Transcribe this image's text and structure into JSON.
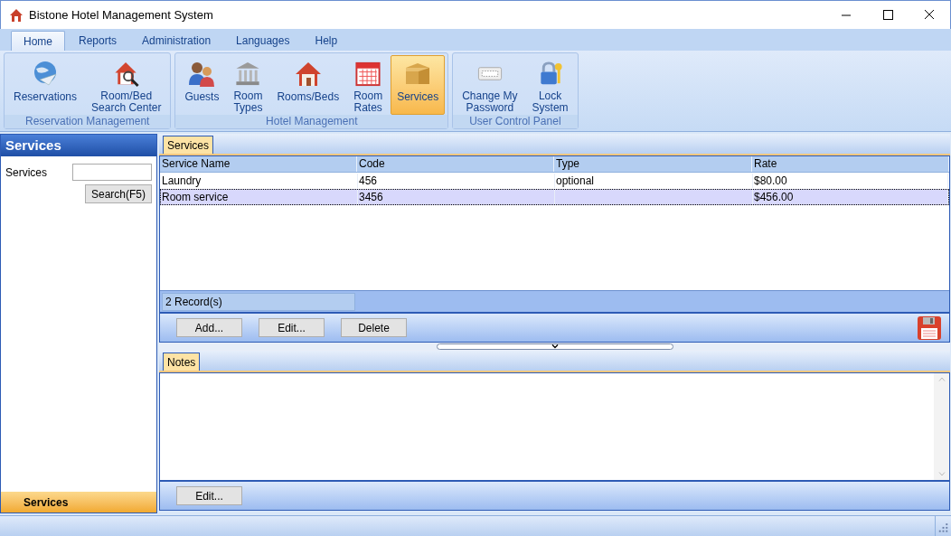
{
  "window": {
    "title": "Bistone Hotel Management System"
  },
  "ribbon_tabs": [
    {
      "label": "Home",
      "selected": true
    },
    {
      "label": "Reports",
      "selected": false
    },
    {
      "label": "Administration",
      "selected": false
    },
    {
      "label": "Languages",
      "selected": false
    },
    {
      "label": "Help",
      "selected": false
    }
  ],
  "ribbon_groups": [
    {
      "title": "Reservation Management",
      "buttons": [
        {
          "label": "Reservations",
          "kind": "globe",
          "selected": false
        },
        {
          "label": "Room/Bed\nSearch Center",
          "kind": "house-search",
          "selected": false
        }
      ]
    },
    {
      "title": "Hotel Management",
      "buttons": [
        {
          "label": "Guests",
          "kind": "people",
          "selected": false
        },
        {
          "label": "Room\nTypes",
          "kind": "building",
          "selected": false
        },
        {
          "label": "Rooms/Beds",
          "kind": "house",
          "selected": false
        },
        {
          "label": "Room\nRates",
          "kind": "calendar",
          "selected": false
        },
        {
          "label": "Services",
          "kind": "box",
          "selected": true
        }
      ]
    },
    {
      "title": "User Control Panel",
      "buttons": [
        {
          "label": "Change My\nPassword",
          "kind": "password",
          "selected": false
        },
        {
          "label": "Lock\nSystem",
          "kind": "lock",
          "selected": false
        }
      ]
    }
  ],
  "sidebar": {
    "title": "Services",
    "search_label": "Services",
    "search_button": "Search(F5)",
    "footer": "Services"
  },
  "services_tab": {
    "label": "Services"
  },
  "table": {
    "columns": [
      "Service Name",
      "Code",
      "Type",
      "Rate"
    ],
    "rows": [
      {
        "cells": [
          "Laundry",
          "456",
          "optional",
          "$80.00"
        ],
        "selected": false
      },
      {
        "cells": [
          "Room service",
          "3456",
          "",
          "$456.00"
        ],
        "selected": true
      }
    ],
    "record_count": "2 Record(s)"
  },
  "actions": [
    "Add...",
    "Edit...",
    "Delete"
  ],
  "notes_tab": {
    "label": "Notes"
  },
  "notes_actions": [
    "Edit..."
  ]
}
